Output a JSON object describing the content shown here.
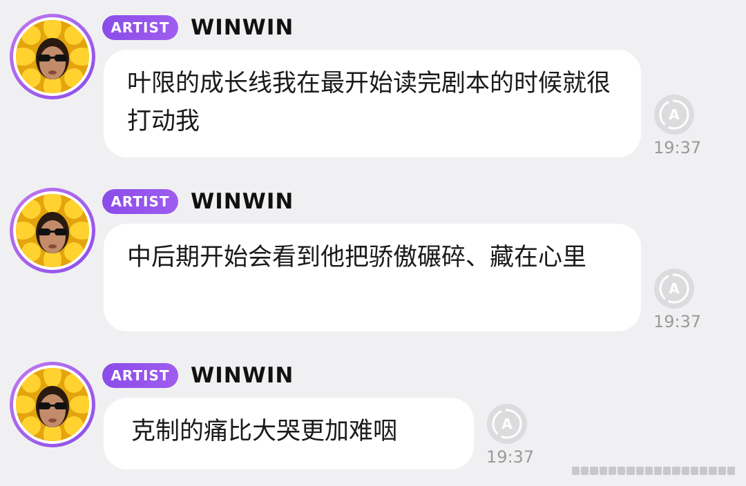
{
  "messages": [
    {
      "badge": "ARTIST",
      "username": "WINWIN",
      "text": "叶限的成长线我在最开始读完剧本的时候就很打动我",
      "time": "19:37",
      "status_icon": "translate-a-icon"
    },
    {
      "badge": "ARTIST",
      "username": "WINWIN",
      "text": "中后期开始会看到他把骄傲碾碎、藏在心里",
      "time": "19:37",
      "status_icon": "translate-a-icon"
    },
    {
      "badge": "ARTIST",
      "username": "WINWIN",
      "text": "克制的痛比大哭更加难咽",
      "time": "19:37",
      "status_icon": "translate-a-icon"
    }
  ],
  "colors": {
    "background": "#f0f0f2",
    "badge": "#8a4de8",
    "bubble": "#ffffff",
    "time": "#9a9a9a",
    "avatar_ring": "#a765ee",
    "sunflower": "#f6c21a"
  }
}
